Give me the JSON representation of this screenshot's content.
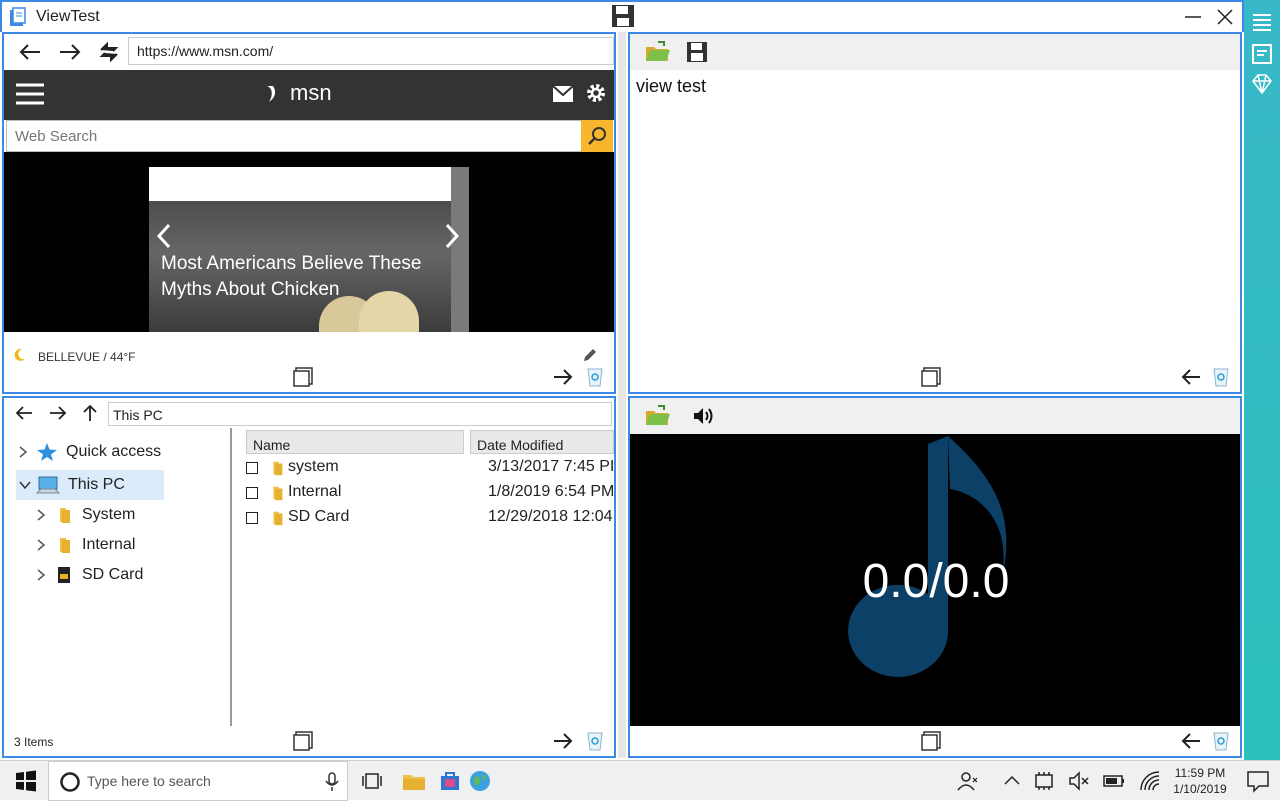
{
  "app": {
    "title": "ViewTest"
  },
  "browser": {
    "url": "https://www.msn.com/",
    "brand": "msn",
    "search_placeholder": "Web Search",
    "hero_caption": "Most Americans Believe These Myths About Chicken",
    "weather": "BELLEVUE / 44°F"
  },
  "text_pane": {
    "content": "view test"
  },
  "files": {
    "path": "This PC",
    "tree": [
      "Quick access",
      "This PC",
      "System",
      "Internal",
      "SD Card"
    ],
    "columns": [
      "Name",
      "Date Modified"
    ],
    "rows": [
      {
        "name": "system",
        "date": "3/13/2017 7:45 PI"
      },
      {
        "name": "Internal",
        "date": "1/8/2019 6:54 PM"
      },
      {
        "name": "SD Card",
        "date": "12/29/2018 12:04"
      }
    ],
    "count": "3 Items"
  },
  "media": {
    "time": "0.0/0.0"
  },
  "taskbar": {
    "search_placeholder": "Type here to search",
    "time": "11:59 PM",
    "date": "1/10/2019"
  },
  "colors": {
    "accent": "#3c8ae6",
    "strip": "#2dbdc0",
    "msn_search_btn": "#f8b62d",
    "music_note": "#0f4b78"
  }
}
